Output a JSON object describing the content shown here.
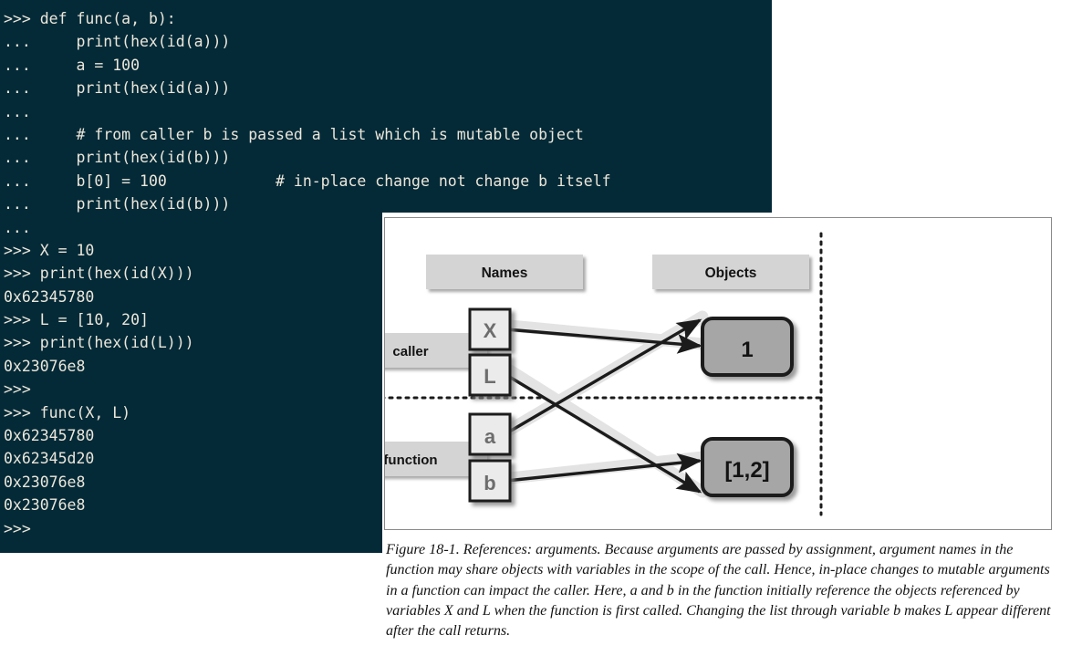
{
  "terminal": {
    "background_color": "#042a38",
    "text_color": "#ece7da",
    "lines": [
      ">>> def func(a, b):",
      "...     print(hex(id(a)))",
      "...     a = 100",
      "...     print(hex(id(a)))",
      "...",
      "...     # from caller b is passed a list which is mutable object",
      "...     print(hex(id(b)))",
      "...     b[0] = 100            # in-place change not change b itself",
      "...     print(hex(id(b)))",
      "...",
      ">>> X = 10",
      ">>> print(hex(id(X)))",
      "0x62345780",
      ">>> L = [10, 20]",
      ">>> print(hex(id(L)))",
      "0x23076e8",
      ">>>",
      ">>> func(X, L)",
      "0x62345780",
      "0x62345d20",
      "0x23076e8",
      "0x23076e8",
      ">>>"
    ]
  },
  "figure": {
    "border_color": "#8a8a8a",
    "headers": {
      "names": "Names",
      "objects": "Objects"
    },
    "scope_labels": {
      "caller": "caller",
      "function": "function"
    },
    "name_boxes": [
      {
        "label": "X",
        "scope": "caller"
      },
      {
        "label": "L",
        "scope": "caller"
      },
      {
        "label": "a",
        "scope": "function"
      },
      {
        "label": "b",
        "scope": "function"
      }
    ],
    "object_boxes": [
      {
        "label": "1"
      },
      {
        "label": "[1,2]"
      }
    ],
    "references": [
      {
        "from": "X",
        "to": "1"
      },
      {
        "from": "L",
        "to": "[1,2]"
      },
      {
        "from": "a",
        "to": "1"
      },
      {
        "from": "b",
        "to": "[1,2]"
      }
    ],
    "colors": {
      "name_box_fill": "#ebebeb",
      "object_box_fill": "#a6a6a6",
      "header_box_fill": "#d4d4d4",
      "scope_box_fill": "#d4d4d4",
      "arrow_color": "#1b1b1b",
      "divider_color": "#1b1b1b"
    }
  },
  "caption": {
    "text": "Figure 18-1. References: arguments. Because arguments are passed by assignment, argument names in the function may share objects with variables in the scope of the call. Hence, in-place changes to mutable arguments in a function can impact the caller. Here, a and b in the function initially reference the objects referenced by variables X and L when the function is first called. Changing the list through variable b makes L appear different after the call returns."
  }
}
